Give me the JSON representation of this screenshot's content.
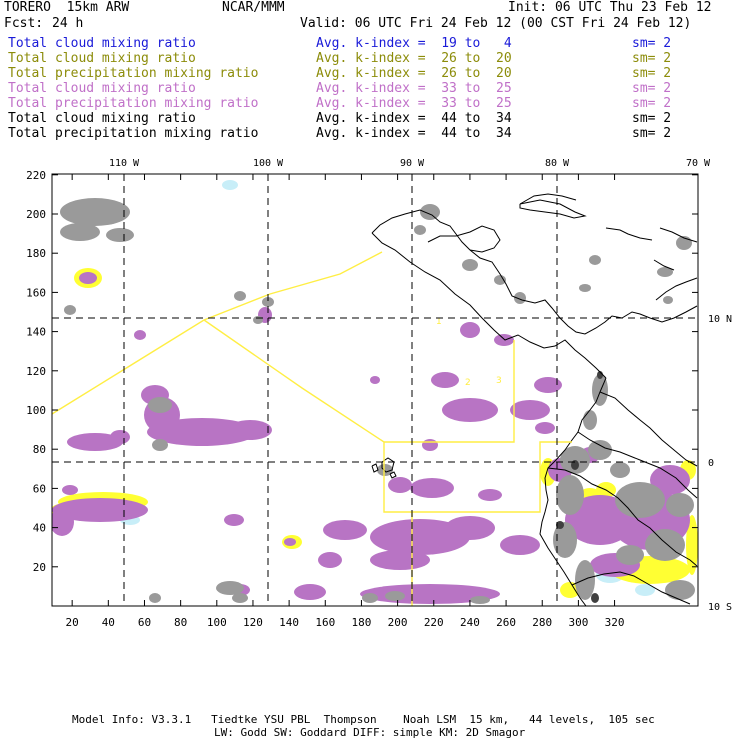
{
  "header": {
    "model": "TORERO  15km ARW",
    "org": "NCAR/MMM",
    "init": "Init: 06 UTC Thu 23 Feb 12",
    "fcst_label": "Fcst:",
    "fcst_value": "24 h",
    "valid": "Valid: 06 UTC Fri 24 Feb 12 (00 CST Fri 24 Feb 12)"
  },
  "legend": [
    {
      "field": "Total cloud mixing ratio",
      "kindex": "Avg. k-index =  19 to   4",
      "sm": "sm= 2",
      "color": "#1a1ad8"
    },
    {
      "field": "Total cloud mixing ratio",
      "kindex": "Avg. k-index =  26 to  20",
      "sm": "sm= 2",
      "color": "#8c8c0a"
    },
    {
      "field": "Total precipitation mixing ratio",
      "kindex": "Avg. k-index =  26 to  20",
      "sm": "sm= 2",
      "color": "#8c8c0a"
    },
    {
      "field": "Total cloud mixing ratio",
      "kindex": "Avg. k-index =  33 to  25",
      "sm": "sm= 2",
      "color": "#c070c8"
    },
    {
      "field": "Total precipitation mixing ratio",
      "kindex": "Avg. k-index =  33 to  25",
      "sm": "sm= 2",
      "color": "#c070c8"
    },
    {
      "field": "Total cloud mixing ratio",
      "kindex": "Avg. k-index =  44 to  34",
      "sm": "sm= 2",
      "color": "#000000"
    },
    {
      "field": "Total precipitation mixing ratio",
      "kindex": "Avg. k-index =  44 to  34",
      "sm": "sm= 2",
      "color": "#000000"
    }
  ],
  "axes": {
    "x_ticks": [
      "20",
      "40",
      "60",
      "80",
      "100",
      "120",
      "140",
      "160",
      "180",
      "200",
      "220",
      "240",
      "260",
      "280",
      "300",
      "320"
    ],
    "y_ticks": [
      "220",
      "200",
      "180",
      "160",
      "140",
      "120",
      "100",
      "80",
      "60",
      "40",
      "20"
    ],
    "lon_labels": [
      "110 W",
      "100 W",
      "90 W",
      "80 W",
      "70 W"
    ],
    "lat_labels": [
      "10 N",
      "0",
      "10 S"
    ]
  },
  "footer": {
    "line1": "Model Info: V3.3.1   Tiedtke YSU PBL  Thompson    Noah LSM  15 km,   44 levels,  105 sec",
    "line2": "LW: Godd SW: Goddard DIFF: simple KM: 2D Smagor"
  },
  "colors": {
    "cloud_gray": "#9a9a9a",
    "precip_purple": "#b874c4",
    "low_yellow": "#ffff33",
    "light_cyan": "#c8eef8",
    "boundary_yellow": "#ffee44"
  }
}
